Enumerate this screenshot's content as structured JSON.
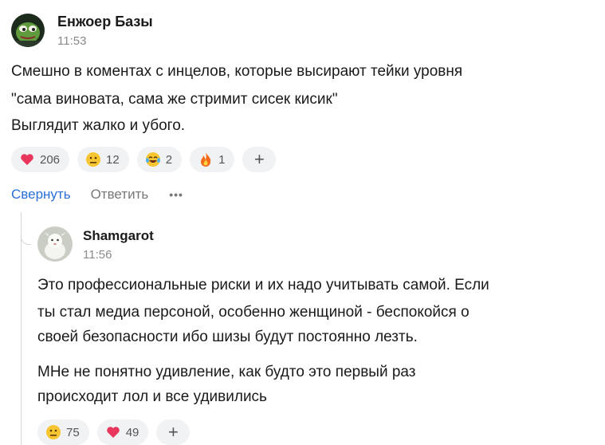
{
  "comment": {
    "author": "Енжоер Базы",
    "time": "11:53",
    "lines": [
      "Смешно в коментах с инцелов, которые высирают тейки уровня",
      "\"сама виновата, сама же стримит сисек кисик\"",
      "Выглядит жалко и убого."
    ],
    "reactions": [
      {
        "icon": "heart-icon",
        "count": "206"
      },
      {
        "icon": "neutral-face-icon",
        "count": "12"
      },
      {
        "icon": "tears-of-joy-icon",
        "count": "2"
      },
      {
        "icon": "fire-icon",
        "count": "1"
      }
    ],
    "add_reaction": "+",
    "actions": {
      "collapse": "Свернуть",
      "reply": "Ответить",
      "more": "•••"
    }
  },
  "reply": {
    "author": "Shamgarot",
    "time": "11:56",
    "paragraph1": [
      "Это профессиональные риски и их надо учитывать самой. Если",
      "ты стал медиа персоной, особенно женщиной - беспокойся о",
      "своей безопасности ибо шизы будут постоянно лезть."
    ],
    "paragraph2": [
      "МНе не понятно удивление, как будто это первый раз",
      "происходит лол и все удивились"
    ],
    "reactions": [
      {
        "icon": "neutral-face-icon",
        "count": "75"
      },
      {
        "icon": "heart-icon",
        "count": "49"
      }
    ],
    "add_reaction": "+"
  },
  "colors": {
    "accent": "#2a6fd6",
    "pill_bg": "#f1f2f4",
    "muted": "#8a8a8a"
  }
}
